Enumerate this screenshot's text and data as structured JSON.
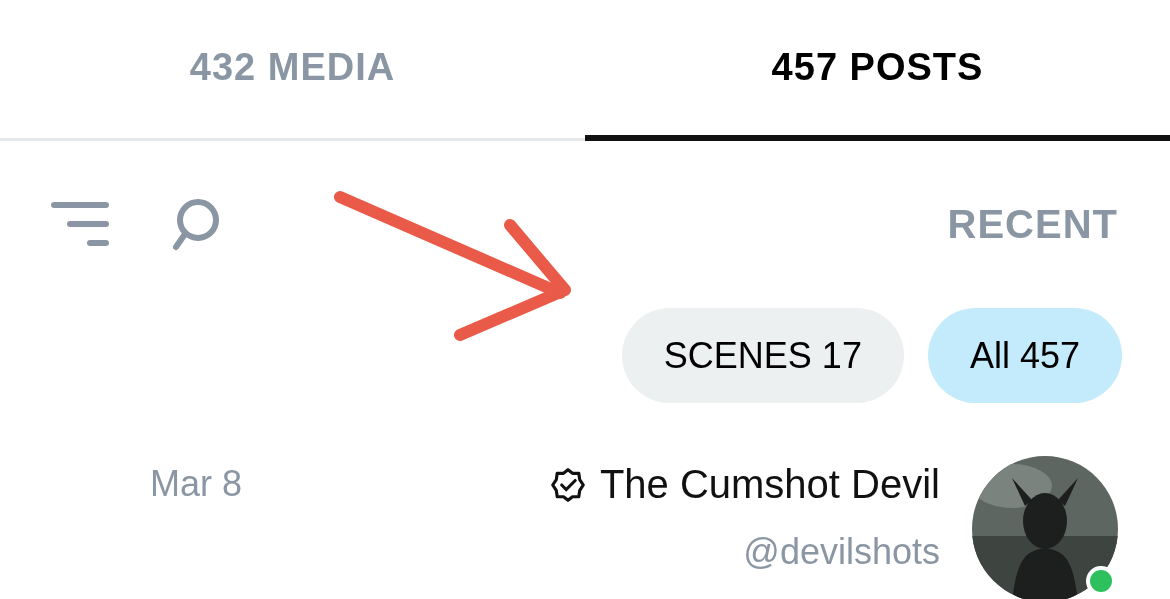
{
  "tabs": [
    {
      "label": "432 MEDIA",
      "selected": false
    },
    {
      "label": "457 POSTS",
      "selected": true
    }
  ],
  "sort": {
    "label": "RECENT"
  },
  "chips": [
    {
      "label": "SCENES 17",
      "selected": false
    },
    {
      "label": "All 457",
      "selected": true
    }
  ],
  "post": {
    "author": "The Cumshot Devil",
    "verified": true,
    "handle": "@devilshots",
    "date": "Mar 8",
    "online": true
  }
}
